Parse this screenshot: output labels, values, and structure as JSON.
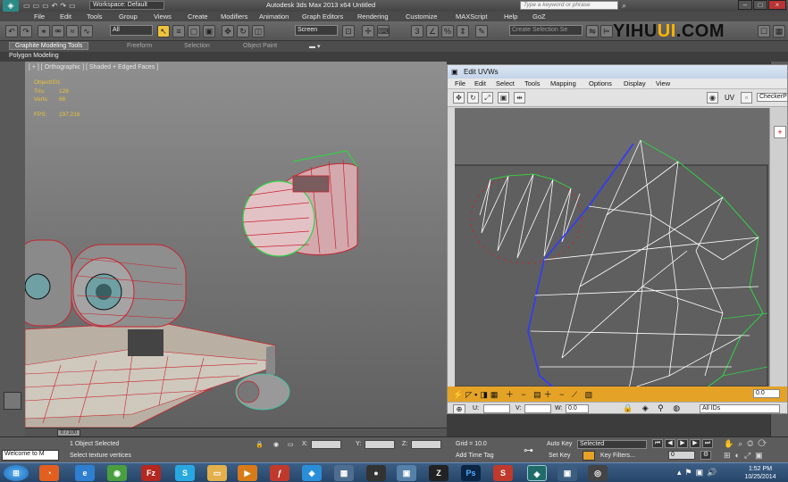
{
  "app": {
    "title": "Autodesk 3ds Max  2013 x64      Untitled",
    "workspace": "Workspace: Default",
    "search_placeholder": "Type a keyword or phrase",
    "watermark_a": "YIHU",
    "watermark_b": "UI",
    "watermark_c": ".COM"
  },
  "menubar": [
    "File",
    "Edit",
    "Tools",
    "Group",
    "Views",
    "Create",
    "Modifiers",
    "Animation",
    "Graph Editors",
    "Rendering",
    "Customize",
    "MAXScript",
    "Help",
    "GoZ"
  ],
  "toolbar": {
    "selection_filter": "All",
    "ref_coord": "Screen",
    "selection_set_placeholder": "Create Selection Se"
  },
  "ribbon": {
    "tabs": [
      "Graphite Modeling Tools",
      "Freeform",
      "Selection",
      "Object Paint"
    ],
    "sub_label": "Polygon Modeling"
  },
  "viewport": {
    "label": "[ + ] [ Orthographic ] [ Shaded + Edged Faces ]",
    "object": "Object001",
    "tris_label": "Tris:",
    "tris": "128",
    "verts_label": "Verts:",
    "verts": "66",
    "fps_label": "FPS:",
    "fps": "197.216"
  },
  "uvw": {
    "title": "Edit UVWs",
    "menus": [
      "File",
      "Edit",
      "Select",
      "Tools",
      "Mapping",
      "Options",
      "Display",
      "View"
    ],
    "uv_label": "UV",
    "checker": "CheckerP",
    "u_label": "U:",
    "v_label": "V:",
    "w_label": "W:",
    "w_value": "0.0",
    "spinner_value": "0.0",
    "filter": "All IDs"
  },
  "timeline": {
    "frame": "0 / 100"
  },
  "status": {
    "selected": "1 Object Selected",
    "prompt": "Select texture vertices",
    "x_label": "X:",
    "y_label": "Y:",
    "z_label": "Z:",
    "grid": "Grid = 10.0",
    "add_time_tag": "Add Time Tag",
    "auto_key": "Auto Key",
    "set_key": "Set Key",
    "key_mode": "Selected",
    "key_filters": "Key Filters...",
    "frame_field": "0",
    "welcome": "Welcome to M"
  },
  "taskbar": {
    "time": "1:52 PM",
    "date": "10/25/2014",
    "icons": [
      "start-icon",
      "firefox-icon",
      "ie-icon",
      "chrome-icon",
      "filezilla-icon",
      "skype-icon",
      "folder-icon",
      "media-icon",
      "flash-icon",
      "dropbox-icon",
      "app-icon",
      "paint-icon",
      "video-icon",
      "zbrush-icon",
      "photoshop-icon",
      "snagit-icon",
      "3dsmax-icon",
      "uv-icon",
      "unity-icon"
    ]
  },
  "colors": {
    "viewport_mesh": "#c8242f",
    "uv_edges": "#ffffff",
    "uv_border": "#32d147",
    "uv_seam": "#2f3aff",
    "timeline_accent": "#e4a227"
  }
}
